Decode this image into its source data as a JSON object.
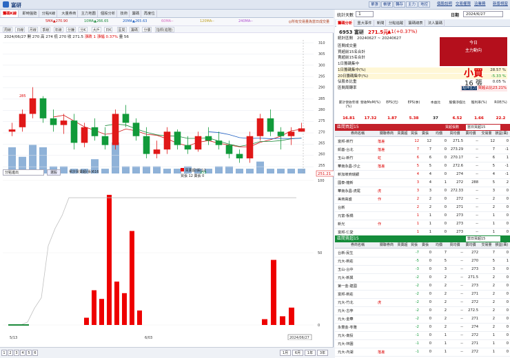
{
  "app": {
    "title": "富研"
  },
  "topbar": {
    "buttons": [
      "單張",
      "帳號",
      "轉存",
      "主力",
      "地控"
    ],
    "links": [
      "個股說明",
      "交易權限",
      "洽業務",
      "新版視窗"
    ]
  },
  "tabs1": [
    "籌碼K線",
    "即時盤勢",
    "分點K線",
    "大量券商",
    "主力地圖",
    "個股分析",
    "技術",
    "籌碼",
    "再度位"
  ],
  "tabs2": [
    "周線",
    "日線",
    "月線",
    "季線",
    "年線",
    "分鐘",
    "分K",
    "大戶",
    "日K",
    "區間",
    "籌碼",
    "分價",
    "指標(進階)"
  ],
  "ma": [
    "5MA▲270.90",
    "10MA▲266.65",
    "20MA▲265.63",
    "60MA--",
    "120MA--",
    "240MA--"
  ],
  "priceinfo": {
    "date": "2024/06/27",
    "open": "開 270",
    "high": "高 274",
    "low": "低 270",
    "close": "收 271.5",
    "change": "漲跌 1",
    "pct": "漲幅 0.37%",
    "vol": "量 56"
  },
  "price_axis": [
    "310",
    "305",
    "300",
    "295",
    "290",
    "285",
    "280",
    "275",
    "270",
    "265",
    "260",
    "255",
    "251.21"
  ],
  "high_label": "285",
  "low_label": "253",
  "highlight_label": "251.21",
  "chart_note": "◎所有交易量為當日成交量",
  "subpanel": {
    "select": "分點進出",
    "btn": "選股",
    "legend1": "累計買賣超(張)616",
    "legend2": "買賣超(張)12",
    "legend3": "買張 12 賣張 0"
  },
  "sub_axis": [
    "100",
    "50",
    "0"
  ],
  "xaxis": {
    "start": "5/13",
    "start_year": "2024",
    "mid": "6/03",
    "end": "2024/06/27"
  },
  "bottom": {
    "pages": [
      "1",
      "2",
      "3",
      "4",
      "5",
      "6"
    ],
    "periods": [
      "1月",
      "6月",
      "1年",
      "3年"
    ]
  },
  "right": {
    "daysel": "統計天數",
    "days": "1",
    "date_label": "日期",
    "date": "2024/6/27",
    "tabs": [
      "籌碼分析",
      "重大事件",
      "新聞",
      "分點追蹤",
      "籌碼總表",
      "法人籌碼"
    ],
    "stock": "6953 富研",
    "price": "271.5元",
    "change": "▲1(+0.37%)",
    "period_label": "統計區間",
    "period": "20240627 ~ 20240627",
    "stats": [
      {
        "l": "區間成交量",
        "v": "56 張"
      },
      {
        "l": "買超前15名合計",
        "v": "50 張"
      },
      {
        "l": "賣超前15名合計",
        "v": "-34 張"
      },
      {
        "l": "1日籌碼集中",
        "v": "16 張"
      },
      {
        "l": "1日籌碼集中(%)",
        "v": "28.57 %"
      },
      {
        "l": "20日籌碼集中(%)",
        "v": "-5.33 %"
      },
      {
        "l": "佔股本比重",
        "v": "0.05 %"
      },
      {
        "l": "區間周轉率",
        "v": "0.19 %"
      }
    ],
    "today": "今日",
    "main_force": "主力動向",
    "action": "小買",
    "action_qty": "16 張",
    "short_label": "短沖主力",
    "short_value": "買超占比23.21%",
    "indicators": [
      {
        "l": "累計營收年增(%)",
        "v": "16.81"
      },
      {
        "l": "營收MoM(%)",
        "v": "17.32"
      },
      {
        "l": "EPS(元)",
        "v": "1.87"
      },
      {
        "l": "EPS(季)",
        "v": "5.38"
      },
      {
        "l": "本益比",
        "v": "37"
      },
      {
        "l": "股價淨值比",
        "v": "6.52"
      },
      {
        "l": "殖利率(%)",
        "v": "1.66"
      },
      {
        "l": "ROE(%)",
        "v": "22.2"
      }
    ],
    "buy_title": "區間買超15",
    "sell_title": "區間賣超15",
    "sort_label": "買超張數",
    "filter": "當日買超15",
    "headers": [
      "券商名稱",
      "關聯券商",
      "買賣超",
      "買張",
      "賣張",
      "均價",
      "買均價",
      "賣均價",
      "交易量",
      "損益(萬)"
    ],
    "buy_rows": [
      [
        "富邦-新竹",
        "落差",
        "12",
        "12",
        "0",
        "271.5",
        "--",
        "12",
        "0"
      ],
      [
        "凱基-台北",
        "落差",
        "7",
        "7",
        "0",
        "273.29",
        "--",
        "7",
        "-1"
      ],
      [
        "玉山-新竹",
        "虹",
        "6",
        "6",
        "0",
        "270.17",
        "--",
        "6",
        "1"
      ],
      [
        "華南永昌-汐止",
        "落差",
        "5",
        "5",
        "0",
        "272.6",
        "--",
        "5",
        "-1"
      ],
      [
        "新加坡商瑞銀",
        "",
        "4",
        "4",
        "0",
        "274",
        "--",
        "4",
        "-1"
      ],
      [
        "國泰-龍新",
        "",
        "3",
        "4",
        "1",
        "272",
        "288",
        "5",
        "2"
      ],
      [
        "華南永昌-虎尾",
        "虎",
        "3",
        "3",
        "0",
        "272.33",
        "--",
        "3",
        "0"
      ],
      [
        "美商高盛",
        "作",
        "2",
        "2",
        "0",
        "272",
        "--",
        "2",
        "0"
      ],
      [
        "台新",
        "",
        "2",
        "2",
        "0",
        "271",
        "--",
        "2",
        "0"
      ],
      [
        "元富-板橋",
        "",
        "1",
        "1",
        "0",
        "273",
        "--",
        "1",
        "0"
      ],
      [
        "新光",
        "作",
        "1",
        "1",
        "0",
        "273",
        "--",
        "1",
        "0"
      ],
      [
        "富邦-仁愛",
        "",
        "1",
        "1",
        "0",
        "273",
        "--",
        "1",
        "0"
      ]
    ],
    "sell_rows": [
      [
        "台新-民生",
        "",
        "-7",
        "0",
        "7",
        "--",
        "272",
        "7",
        "0"
      ],
      [
        "元大-新莊",
        "",
        "-5",
        "0",
        "5",
        "--",
        "270",
        "5",
        "1"
      ],
      [
        "玉山-台中",
        "",
        "-3",
        "0",
        "3",
        "--",
        "273",
        "3",
        "0"
      ],
      [
        "元大-新興",
        "",
        "-2",
        "0",
        "2",
        "--",
        "271.5",
        "2",
        "0"
      ],
      [
        "第一金-建國",
        "",
        "-2",
        "0",
        "2",
        "--",
        "273",
        "2",
        "0"
      ],
      [
        "富邦-新莊",
        "",
        "-2",
        "0",
        "2",
        "--",
        "271",
        "2",
        "0"
      ],
      [
        "元大-竹北",
        "虎",
        "-2",
        "0",
        "2",
        "--",
        "272",
        "2",
        "0"
      ],
      [
        "元大-古亭",
        "",
        "-2",
        "0",
        "2",
        "--",
        "272.5",
        "2",
        "0"
      ],
      [
        "元大-金華",
        "",
        "-2",
        "0",
        "2",
        "--",
        "271",
        "2",
        "0"
      ],
      [
        "永豐金-苓雅",
        "",
        "-2",
        "0",
        "2",
        "--",
        "274",
        "2",
        "0"
      ],
      [
        "元大-南投",
        "",
        "-1",
        "0",
        "1",
        "--",
        "272",
        "1",
        "0"
      ],
      [
        "元大-林園",
        "",
        "-1",
        "0",
        "1",
        "--",
        "271",
        "1",
        "0"
      ],
      [
        "元大-內湖",
        "落差",
        "-1",
        "0",
        "1",
        "--",
        "272",
        "1",
        "0"
      ]
    ]
  },
  "chart_data": {
    "type": "candlestick",
    "title": "",
    "x_start": "2024/05/13",
    "x_end": "2024/06/27",
    "ylim": [
      251.21,
      310
    ],
    "candles": [
      [
        270,
        274,
        268,
        271
      ],
      [
        272,
        280,
        270,
        278
      ],
      [
        278,
        290,
        276,
        285
      ],
      [
        285,
        286,
        274,
        276
      ],
      [
        276,
        280,
        270,
        273
      ],
      [
        273,
        278,
        269,
        275
      ],
      [
        275,
        278,
        262,
        265
      ],
      [
        265,
        274,
        263,
        272
      ],
      [
        272,
        276,
        266,
        268
      ],
      [
        268,
        272,
        262,
        264
      ],
      [
        264,
        280,
        262,
        278
      ],
      [
        278,
        282,
        272,
        274
      ],
      [
        274,
        276,
        266,
        268
      ],
      [
        268,
        272,
        258,
        260
      ],
      [
        260,
        266,
        258,
        262
      ],
      [
        262,
        272,
        260,
        270
      ],
      [
        270,
        271,
        262,
        264
      ],
      [
        264,
        268,
        260,
        262
      ],
      [
        262,
        270,
        261,
        268
      ],
      [
        268,
        272,
        264,
        266
      ],
      [
        266,
        270,
        262,
        264
      ],
      [
        264,
        266,
        258,
        260
      ],
      [
        260,
        262,
        256,
        258
      ],
      [
        258,
        270,
        256,
        268
      ],
      [
        268,
        278,
        266,
        276
      ],
      [
        276,
        280,
        268,
        270
      ],
      [
        270,
        272,
        262,
        268
      ],
      [
        268,
        272,
        264,
        270
      ],
      [
        270,
        274,
        270,
        271.5
      ]
    ],
    "volume": [
      11,
      7,
      12,
      11,
      3,
      3,
      2,
      2,
      6,
      2,
      13,
      3,
      3,
      3,
      3,
      2,
      2,
      3,
      2,
      2,
      3,
      3,
      2,
      2,
      5,
      2,
      2,
      2,
      2
    ],
    "net_buy": [
      0,
      0,
      5,
      24,
      18,
      90,
      30,
      22,
      65,
      10,
      0,
      0,
      0,
      0,
      0,
      0,
      0,
      0,
      0,
      0,
      0,
      0,
      0,
      0,
      0,
      0,
      0,
      0,
      0
    ],
    "net_buy_tail": [
      4,
      45,
      6,
      12
    ],
    "sub_ylim": [
      0,
      100
    ]
  }
}
